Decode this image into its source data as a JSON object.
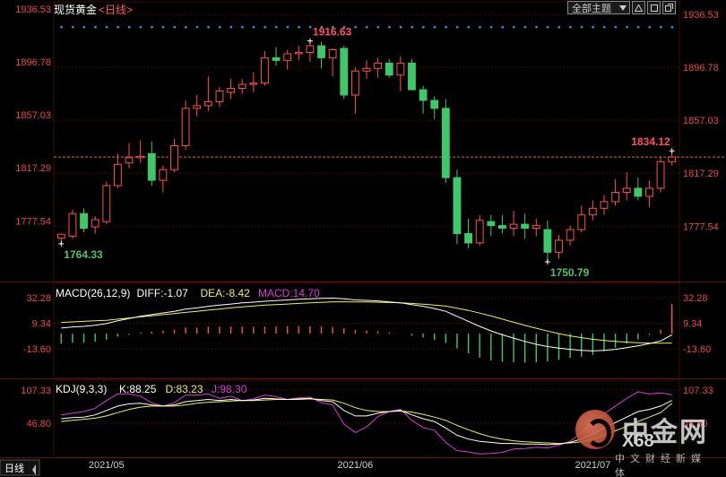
{
  "header": {
    "title": "现货黄金",
    "period_label": "<日线>",
    "theme_select": "全部主题",
    "buttons": [
      "triangle-up-icon",
      "square-icon",
      "maximize-icon"
    ]
  },
  "colors": {
    "up": "#ff4f4f",
    "down": "#3ec86a",
    "axis": "#e8474c",
    "grid": "#3a0c0c",
    "dot": "#3e86d0",
    "last_line": "#e06a3a",
    "diff": "#ffffff",
    "dea": "#f0f05a",
    "macd": "#d83cd8",
    "k": "#ffffff",
    "d": "#f0f05a",
    "j": "#d83cd8"
  },
  "chart_data": [
    {
      "type": "candlestick",
      "panel": "price",
      "yticks": [
        "1936.53",
        "1896.78",
        "1857.03",
        "1817.29",
        "1777.54"
      ],
      "ylim": [
        1736,
        1946
      ],
      "x_labels": [
        "2021/05",
        "2021/06",
        "2021/07"
      ],
      "x_label_index": [
        4,
        26,
        47
      ],
      "annotations": [
        {
          "label": "1916.63",
          "index": 22,
          "value": 1916.63,
          "kind": "high"
        },
        {
          "label": "1764.33",
          "index": 0,
          "value": 1764.33,
          "kind": "low"
        },
        {
          "label": "1750.79",
          "index": 43,
          "value": 1750.79,
          "kind": "low"
        },
        {
          "label": "1834.12",
          "index": 54,
          "value": 1834.12,
          "kind": "high"
        }
      ],
      "last_price": 1829.5,
      "candles": [
        {
          "o": 1768.5,
          "h": 1772.0,
          "l": 1764.33,
          "c": 1771.5
        },
        {
          "o": 1770.0,
          "h": 1790.0,
          "l": 1768.0,
          "c": 1787.0
        },
        {
          "o": 1787.0,
          "h": 1791.0,
          "l": 1773.0,
          "c": 1776.0
        },
        {
          "o": 1777.0,
          "h": 1785.0,
          "l": 1772.0,
          "c": 1782.5
        },
        {
          "o": 1781.0,
          "h": 1811.0,
          "l": 1779.0,
          "c": 1808.0
        },
        {
          "o": 1808.0,
          "h": 1832.0,
          "l": 1806.0,
          "c": 1824.0
        },
        {
          "o": 1825.0,
          "h": 1840.0,
          "l": 1821.0,
          "c": 1829.0
        },
        {
          "o": 1829.0,
          "h": 1842.0,
          "l": 1825.0,
          "c": 1830.0
        },
        {
          "o": 1832.0,
          "h": 1841.0,
          "l": 1808.0,
          "c": 1812.0
        },
        {
          "o": 1812.0,
          "h": 1823.0,
          "l": 1803.0,
          "c": 1820.0
        },
        {
          "o": 1820.0,
          "h": 1843.0,
          "l": 1818.0,
          "c": 1838.0
        },
        {
          "o": 1838.0,
          "h": 1872.0,
          "l": 1835.0,
          "c": 1866.0
        },
        {
          "o": 1866.0,
          "h": 1876.0,
          "l": 1860.0,
          "c": 1868.0
        },
        {
          "o": 1868.0,
          "h": 1890.0,
          "l": 1864.0,
          "c": 1871.0
        },
        {
          "o": 1871.0,
          "h": 1882.0,
          "l": 1867.0,
          "c": 1879.0
        },
        {
          "o": 1878.0,
          "h": 1888.0,
          "l": 1873.0,
          "c": 1881.0
        },
        {
          "o": 1881.0,
          "h": 1888.0,
          "l": 1877.0,
          "c": 1884.0
        },
        {
          "o": 1884.0,
          "h": 1893.0,
          "l": 1878.0,
          "c": 1885.0
        },
        {
          "o": 1885.0,
          "h": 1909.0,
          "l": 1883.0,
          "c": 1904.0
        },
        {
          "o": 1904.0,
          "h": 1912.0,
          "l": 1898.0,
          "c": 1902.0
        },
        {
          "o": 1902.0,
          "h": 1910.0,
          "l": 1895.0,
          "c": 1907.0
        },
        {
          "o": 1907.0,
          "h": 1913.0,
          "l": 1902.0,
          "c": 1908.0
        },
        {
          "o": 1908.0,
          "h": 1916.63,
          "l": 1901.0,
          "c": 1913.0
        },
        {
          "o": 1913.0,
          "h": 1916.0,
          "l": 1896.0,
          "c": 1904.0
        },
        {
          "o": 1904.0,
          "h": 1911.0,
          "l": 1890.0,
          "c": 1910.0
        },
        {
          "o": 1911.0,
          "h": 1913.0,
          "l": 1873.0,
          "c": 1876.0
        },
        {
          "o": 1876.0,
          "h": 1897.0,
          "l": 1862.0,
          "c": 1894.0
        },
        {
          "o": 1894.0,
          "h": 1902.0,
          "l": 1888.0,
          "c": 1896.0
        },
        {
          "o": 1896.0,
          "h": 1904.0,
          "l": 1889.0,
          "c": 1900.0
        },
        {
          "o": 1900.0,
          "h": 1903.0,
          "l": 1889.0,
          "c": 1891.0
        },
        {
          "o": 1891.0,
          "h": 1905.0,
          "l": 1879.0,
          "c": 1900.0
        },
        {
          "o": 1900.0,
          "h": 1903.0,
          "l": 1880.0,
          "c": 1880.0
        },
        {
          "o": 1880.0,
          "h": 1883.0,
          "l": 1862.0,
          "c": 1872.0
        },
        {
          "o": 1872.0,
          "h": 1875.0,
          "l": 1858.0,
          "c": 1866.0
        },
        {
          "o": 1866.0,
          "h": 1873.0,
          "l": 1810.0,
          "c": 1814.0
        },
        {
          "o": 1814.0,
          "h": 1820.0,
          "l": 1764.0,
          "c": 1772.0
        },
        {
          "o": 1772.0,
          "h": 1783.0,
          "l": 1761.0,
          "c": 1765.0
        },
        {
          "o": 1765.0,
          "h": 1786.0,
          "l": 1763.0,
          "c": 1782.0
        },
        {
          "o": 1781.0,
          "h": 1786.0,
          "l": 1770.0,
          "c": 1778.0
        },
        {
          "o": 1778.0,
          "h": 1786.0,
          "l": 1772.0,
          "c": 1776.0
        },
        {
          "o": 1776.0,
          "h": 1789.0,
          "l": 1770.0,
          "c": 1779.0
        },
        {
          "o": 1779.0,
          "h": 1787.0,
          "l": 1768.0,
          "c": 1776.0
        },
        {
          "o": 1776.0,
          "h": 1783.0,
          "l": 1770.0,
          "c": 1778.0
        },
        {
          "o": 1775.0,
          "h": 1782.0,
          "l": 1750.79,
          "c": 1758.0
        },
        {
          "o": 1758.0,
          "h": 1771.0,
          "l": 1753.0,
          "c": 1767.0
        },
        {
          "o": 1767.0,
          "h": 1778.0,
          "l": 1763.0,
          "c": 1775.0
        },
        {
          "o": 1775.0,
          "h": 1793.0,
          "l": 1773.0,
          "c": 1786.0
        },
        {
          "o": 1786.0,
          "h": 1797.0,
          "l": 1782.0,
          "c": 1791.0
        },
        {
          "o": 1791.0,
          "h": 1801.0,
          "l": 1786.0,
          "c": 1796.0
        },
        {
          "o": 1796.0,
          "h": 1813.0,
          "l": 1793.0,
          "c": 1803.0
        },
        {
          "o": 1803.0,
          "h": 1818.0,
          "l": 1797.0,
          "c": 1806.0
        },
        {
          "o": 1806.0,
          "h": 1814.0,
          "l": 1797.0,
          "c": 1800.0
        },
        {
          "o": 1800.0,
          "h": 1812.0,
          "l": 1792.0,
          "c": 1806.0
        },
        {
          "o": 1806.0,
          "h": 1830.0,
          "l": 1803.0,
          "c": 1826.0
        },
        {
          "o": 1826.0,
          "h": 1834.12,
          "l": 1823.0,
          "c": 1829.5
        }
      ]
    },
    {
      "type": "line",
      "panel": "macd",
      "legend": [
        {
          "text": "MACD(26,12,9)",
          "color": "#ffffff"
        },
        {
          "text": "DIFF:-1.07",
          "color": "#ffffff"
        },
        {
          "text": "DEA:-8.42",
          "color": "#f0f05a"
        },
        {
          "text": "MACD:14.70",
          "color": "#d83cd8"
        }
      ],
      "yticks": [
        "32.28",
        "9.34",
        "-13.60"
      ],
      "ylim": [
        -40,
        45
      ],
      "diff": [
        5,
        6,
        6.5,
        7.5,
        9,
        11.5,
        13.5,
        15.5,
        17,
        18.5,
        20,
        22,
        23,
        24.5,
        25.5,
        26.5,
        27.5,
        28.2,
        29,
        29.5,
        30.2,
        30.8,
        31.2,
        31.5,
        31.8,
        31.2,
        30.2,
        29.8,
        29.3,
        28.4,
        27.5,
        26,
        24.5,
        22.5,
        20,
        15.5,
        11,
        6.5,
        2.5,
        -1,
        -4,
        -7,
        -9.5,
        -11.5,
        -13,
        -14,
        -15,
        -15.5,
        -15,
        -14,
        -12.5,
        -11,
        -9,
        -6.5,
        -1.07
      ],
      "dea": [
        10,
        10.5,
        11,
        11.5,
        12,
        13,
        14,
        15,
        16,
        17,
        18,
        19,
        20,
        21,
        22,
        23,
        24,
        24.8,
        25.5,
        26,
        26.5,
        27,
        27.5,
        28,
        28.5,
        28.5,
        28.4,
        28.3,
        28.1,
        27.8,
        27.5,
        27,
        26.4,
        25.6,
        24.6,
        22.8,
        20.8,
        18.4,
        15.8,
        13,
        10.2,
        7.4,
        4.8,
        2.3,
        0,
        -2,
        -3.6,
        -5,
        -6.2,
        -7,
        -7.6,
        -8.1,
        -8.4,
        -8.5,
        -8.42
      ],
      "macd": [
        -5,
        -4.5,
        -4.5,
        -4,
        -3,
        -1.5,
        -0.5,
        0.5,
        1,
        1.5,
        2,
        3,
        3,
        3.5,
        3.5,
        3.5,
        3.5,
        3.4,
        3.5,
        3.5,
        3.7,
        3.8,
        3.7,
        3.5,
        3.3,
        2.7,
        1.8,
        1.5,
        1.2,
        0.6,
        0,
        -1,
        -1.9,
        -3.1,
        -4.6,
        -7.3,
        -9.8,
        -11.9,
        -13.3,
        -14,
        -14.2,
        -14.4,
        -14.3,
        -13.8,
        -13,
        -12,
        -11.4,
        -10.5,
        -8.8,
        -7,
        -4.9,
        -2.9,
        -0.6,
        2,
        14.7
      ]
    },
    {
      "type": "line",
      "panel": "kdj",
      "legend": [
        {
          "text": "KDJ(9,3,3)",
          "color": "#ffffff"
        },
        {
          "text": "K:88.25",
          "color": "#ffffff"
        },
        {
          "text": "D:83.23",
          "color": "#f0f05a"
        },
        {
          "text": "J:98.30",
          "color": "#d83cd8"
        }
      ],
      "yticks": [
        "107.33",
        "46.80"
      ],
      "ylim": [
        -15,
        125
      ],
      "k": [
        55,
        57,
        58,
        62,
        70,
        78,
        82,
        83,
        80,
        78,
        80,
        86,
        88,
        90,
        88,
        90,
        88,
        89,
        92,
        91,
        90,
        91,
        92,
        88,
        86,
        70,
        60,
        60,
        65,
        68,
        70,
        62,
        55,
        50,
        38,
        25,
        18,
        14,
        12,
        10,
        10,
        9,
        9,
        8,
        9,
        12,
        18,
        28,
        38,
        48,
        58,
        68,
        72,
        78,
        88.25
      ],
      "d": [
        50,
        52,
        54,
        56,
        60,
        66,
        72,
        76,
        78,
        78,
        78,
        80,
        83,
        85,
        86,
        87,
        88,
        88,
        89,
        90,
        90,
        90,
        91,
        90,
        89,
        83,
        75,
        70,
        68,
        68,
        69,
        67,
        63,
        58,
        52,
        43,
        35,
        28,
        22,
        18,
        15,
        13,
        12,
        11,
        10,
        11,
        13,
        18,
        25,
        33,
        41,
        50,
        58,
        66,
        83.23
      ],
      "j": [
        62,
        65,
        68,
        74,
        88,
        100,
        100,
        96,
        84,
        78,
        84,
        98,
        98,
        100,
        92,
        96,
        88,
        91,
        98,
        95,
        90,
        93,
        94,
        84,
        80,
        45,
        30,
        40,
        59,
        68,
        72,
        52,
        39,
        34,
        12,
        -3,
        -5,
        -9,
        -8,
        -6,
        0,
        1,
        3,
        2,
        7,
        14,
        30,
        48,
        64,
        78,
        92,
        104,
        100,
        102,
        98.3
      ]
    }
  ]
}
